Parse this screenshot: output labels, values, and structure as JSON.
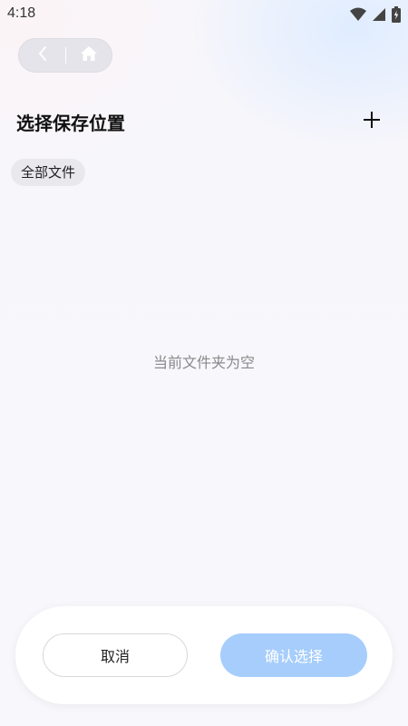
{
  "status_bar": {
    "time": "4:18",
    "icons": [
      "wifi-icon",
      "signal-icon",
      "battery-charging-icon"
    ]
  },
  "nav": {
    "icons": [
      "chevron-left-icon",
      "home-icon"
    ]
  },
  "header": {
    "title": "选择保存位置",
    "add_icon": "plus-icon"
  },
  "breadcrumb": {
    "label": "全部文件"
  },
  "content": {
    "empty_message": "当前文件夹为空"
  },
  "actions": {
    "cancel_label": "取消",
    "confirm_label": "确认选择"
  },
  "colors": {
    "confirm_button": "#a6cdfb",
    "empty_text": "#8a8a8a"
  }
}
